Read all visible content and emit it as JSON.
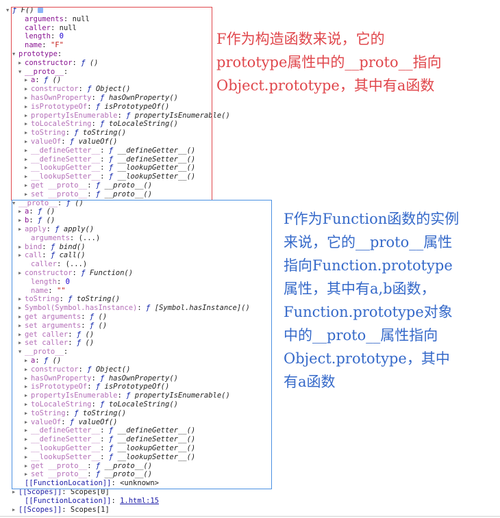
{
  "console_tree": {
    "rows": [
      {
        "indent": 18,
        "arrow": "▼",
        "key": "",
        "sep": "",
        "val_kind": "fn",
        "val": "F()",
        "info": true,
        "key_style": "normal"
      },
      {
        "indent": 36,
        "arrow": "",
        "key": "arguments",
        "sep": ": ",
        "val_kind": "plain",
        "val": "null",
        "key_style": "normal"
      },
      {
        "indent": 36,
        "arrow": "",
        "key": "caller",
        "sep": ": ",
        "val_kind": "plain",
        "val": "null",
        "key_style": "normal"
      },
      {
        "indent": 36,
        "arrow": "",
        "key": "length",
        "sep": ": ",
        "val_kind": "num",
        "val": "0",
        "key_style": "normal"
      },
      {
        "indent": 36,
        "arrow": "",
        "key": "name",
        "sep": ": ",
        "val_kind": "str",
        "val": "\"F\"",
        "key_style": "normal"
      },
      {
        "indent": 27,
        "arrow": "▼",
        "key": "prototype",
        "sep": ":",
        "val_kind": "plain",
        "val": "",
        "key_style": "normal"
      },
      {
        "indent": 36,
        "arrow": "▶",
        "key": "constructor",
        "sep": ": ",
        "val_kind": "fn",
        "val": "()",
        "key_style": "normal"
      },
      {
        "indent": 36,
        "arrow": "▼",
        "key": "__proto__",
        "sep": ":",
        "val_kind": "plain",
        "val": "",
        "key_style": "normal"
      },
      {
        "indent": 45,
        "arrow": "▶",
        "key": "a",
        "sep": ": ",
        "val_kind": "fn",
        "val": "()",
        "key_style": "normal"
      },
      {
        "indent": 45,
        "arrow": "▶",
        "key": "constructor",
        "sep": ": ",
        "val_kind": "fn",
        "val": "Object()",
        "key_style": "dim"
      },
      {
        "indent": 45,
        "arrow": "▶",
        "key": "hasOwnProperty",
        "sep": ": ",
        "val_kind": "fn",
        "val": "hasOwnProperty()",
        "key_style": "dim"
      },
      {
        "indent": 45,
        "arrow": "▶",
        "key": "isPrototypeOf",
        "sep": ": ",
        "val_kind": "fn",
        "val": "isPrototypeOf()",
        "key_style": "dim"
      },
      {
        "indent": 45,
        "arrow": "▶",
        "key": "propertyIsEnumerable",
        "sep": ": ",
        "val_kind": "fn",
        "val": "propertyIsEnumerable()",
        "key_style": "dim"
      },
      {
        "indent": 45,
        "arrow": "▶",
        "key": "toLocaleString",
        "sep": ": ",
        "val_kind": "fn",
        "val": "toLocaleString()",
        "key_style": "dim"
      },
      {
        "indent": 45,
        "arrow": "▶",
        "key": "toString",
        "sep": ": ",
        "val_kind": "fn",
        "val": "toString()",
        "key_style": "dim"
      },
      {
        "indent": 45,
        "arrow": "▶",
        "key": "valueOf",
        "sep": ": ",
        "val_kind": "fn",
        "val": "valueOf()",
        "key_style": "dim"
      },
      {
        "indent": 45,
        "arrow": "▶",
        "key": "__defineGetter__",
        "sep": ": ",
        "val_kind": "fn",
        "val": "__defineGetter__()",
        "key_style": "dim"
      },
      {
        "indent": 45,
        "arrow": "▶",
        "key": "__defineSetter__",
        "sep": ": ",
        "val_kind": "fn",
        "val": "__defineSetter__()",
        "key_style": "dim"
      },
      {
        "indent": 45,
        "arrow": "▶",
        "key": "__lookupGetter__",
        "sep": ": ",
        "val_kind": "fn",
        "val": "__lookupGetter__()",
        "key_style": "dim"
      },
      {
        "indent": 45,
        "arrow": "▶",
        "key": "__lookupSetter__",
        "sep": ": ",
        "val_kind": "fn",
        "val": "__lookupSetter__()",
        "key_style": "dim"
      },
      {
        "indent": 45,
        "arrow": "▶",
        "key": "get __proto__",
        "sep": ": ",
        "val_kind": "fn",
        "val": "__proto__()",
        "key_style": "dim"
      },
      {
        "indent": 45,
        "arrow": "▶",
        "key": "set __proto__",
        "sep": ": ",
        "val_kind": "fn",
        "val": "__proto__()",
        "key_style": "dim"
      },
      {
        "indent": 27,
        "arrow": "▼",
        "key": "__proto__",
        "sep": ": ",
        "val_kind": "fn",
        "val": "()",
        "key_style": "dim"
      },
      {
        "indent": 36,
        "arrow": "▶",
        "key": "a",
        "sep": ": ",
        "val_kind": "fn",
        "val": "()",
        "key_style": "normal"
      },
      {
        "indent": 36,
        "arrow": "▶",
        "key": "b",
        "sep": ": ",
        "val_kind": "fn",
        "val": "()",
        "key_style": "normal"
      },
      {
        "indent": 36,
        "arrow": "▶",
        "key": "apply",
        "sep": ": ",
        "val_kind": "fn",
        "val": "apply()",
        "key_style": "dim"
      },
      {
        "indent": 45,
        "arrow": "",
        "key": "arguments",
        "sep": ": ",
        "val_kind": "plain",
        "val": "(...)",
        "key_style": "dim"
      },
      {
        "indent": 36,
        "arrow": "▶",
        "key": "bind",
        "sep": ": ",
        "val_kind": "fn",
        "val": "bind()",
        "key_style": "dim"
      },
      {
        "indent": 36,
        "arrow": "▶",
        "key": "call",
        "sep": ": ",
        "val_kind": "fn",
        "val": "call()",
        "key_style": "dim"
      },
      {
        "indent": 45,
        "arrow": "",
        "key": "caller",
        "sep": ": ",
        "val_kind": "plain",
        "val": "(...)",
        "key_style": "dim"
      },
      {
        "indent": 36,
        "arrow": "▶",
        "key": "constructor",
        "sep": ": ",
        "val_kind": "fn",
        "val": "Function()",
        "key_style": "dim"
      },
      {
        "indent": 45,
        "arrow": "",
        "key": "length",
        "sep": ": ",
        "val_kind": "num",
        "val": "0",
        "key_style": "dim"
      },
      {
        "indent": 45,
        "arrow": "",
        "key": "name",
        "sep": ": ",
        "val_kind": "str",
        "val": "\"\"",
        "key_style": "dim"
      },
      {
        "indent": 36,
        "arrow": "▶",
        "key": "toString",
        "sep": ": ",
        "val_kind": "fn",
        "val": "toString()",
        "key_style": "dim"
      },
      {
        "indent": 36,
        "arrow": "▶",
        "key": "Symbol(Symbol.hasInstance)",
        "sep": ": ",
        "val_kind": "fn",
        "val": "[Symbol.hasInstance]()",
        "key_style": "dim"
      },
      {
        "indent": 36,
        "arrow": "▶",
        "key": "get arguments",
        "sep": ": ",
        "val_kind": "fn",
        "val": "()",
        "key_style": "dim"
      },
      {
        "indent": 36,
        "arrow": "▶",
        "key": "set arguments",
        "sep": ": ",
        "val_kind": "fn",
        "val": "()",
        "key_style": "dim"
      },
      {
        "indent": 36,
        "arrow": "▶",
        "key": "get caller",
        "sep": ": ",
        "val_kind": "fn",
        "val": "()",
        "key_style": "dim"
      },
      {
        "indent": 36,
        "arrow": "▶",
        "key": "set caller",
        "sep": ": ",
        "val_kind": "fn",
        "val": "()",
        "key_style": "dim"
      },
      {
        "indent": 36,
        "arrow": "▼",
        "key": "__proto__",
        "sep": ":",
        "val_kind": "plain",
        "val": "",
        "key_style": "dim"
      },
      {
        "indent": 45,
        "arrow": "▶",
        "key": "a",
        "sep": ": ",
        "val_kind": "fn",
        "val": "()",
        "key_style": "normal"
      },
      {
        "indent": 45,
        "arrow": "▶",
        "key": "constructor",
        "sep": ": ",
        "val_kind": "fn",
        "val": "Object()",
        "key_style": "dim"
      },
      {
        "indent": 45,
        "arrow": "▶",
        "key": "hasOwnProperty",
        "sep": ": ",
        "val_kind": "fn",
        "val": "hasOwnProperty()",
        "key_style": "dim"
      },
      {
        "indent": 45,
        "arrow": "▶",
        "key": "isPrototypeOf",
        "sep": ": ",
        "val_kind": "fn",
        "val": "isPrototypeOf()",
        "key_style": "dim"
      },
      {
        "indent": 45,
        "arrow": "▶",
        "key": "propertyIsEnumerable",
        "sep": ": ",
        "val_kind": "fn",
        "val": "propertyIsEnumerable()",
        "key_style": "dim"
      },
      {
        "indent": 45,
        "arrow": "▶",
        "key": "toLocaleString",
        "sep": ": ",
        "val_kind": "fn",
        "val": "toLocaleString()",
        "key_style": "dim"
      },
      {
        "indent": 45,
        "arrow": "▶",
        "key": "toString",
        "sep": ": ",
        "val_kind": "fn",
        "val": "toString()",
        "key_style": "dim"
      },
      {
        "indent": 45,
        "arrow": "▶",
        "key": "valueOf",
        "sep": ": ",
        "val_kind": "fn",
        "val": "valueOf()",
        "key_style": "dim"
      },
      {
        "indent": 45,
        "arrow": "▶",
        "key": "__defineGetter__",
        "sep": ": ",
        "val_kind": "fn",
        "val": "__defineGetter__()",
        "key_style": "dim"
      },
      {
        "indent": 45,
        "arrow": "▶",
        "key": "__defineSetter__",
        "sep": ": ",
        "val_kind": "fn",
        "val": "__defineSetter__()",
        "key_style": "dim"
      },
      {
        "indent": 45,
        "arrow": "▶",
        "key": "__lookupGetter__",
        "sep": ": ",
        "val_kind": "fn",
        "val": "__lookupGetter__()",
        "key_style": "dim"
      },
      {
        "indent": 45,
        "arrow": "▶",
        "key": "__lookupSetter__",
        "sep": ": ",
        "val_kind": "fn",
        "val": "__lookupSetter__()",
        "key_style": "dim"
      },
      {
        "indent": 45,
        "arrow": "▶",
        "key": "get __proto__",
        "sep": ": ",
        "val_kind": "fn",
        "val": "__proto__()",
        "key_style": "dim"
      },
      {
        "indent": 45,
        "arrow": "▶",
        "key": "set __proto__",
        "sep": ": ",
        "val_kind": "fn",
        "val": "__proto__()",
        "key_style": "dim"
      },
      {
        "indent": 36,
        "arrow": "",
        "key": "[[FunctionLocation]]",
        "sep": ": ",
        "val_kind": "plain",
        "val": "<unknown>",
        "key_style": "blue"
      },
      {
        "indent": 27,
        "arrow": "▶",
        "key": "[[Scopes]]",
        "sep": ": ",
        "val_kind": "plain",
        "val": "Scopes[0]",
        "key_style": "blue"
      },
      {
        "indent": 36,
        "arrow": "",
        "key": "[[FunctionLocation]]",
        "sep": ": ",
        "val_kind": "link",
        "val": "1.html:15",
        "key_style": "blue"
      },
      {
        "indent": 27,
        "arrow": "▶",
        "key": "[[Scopes]]",
        "sep": ": ",
        "val_kind": "plain",
        "val": "Scopes[1]",
        "key_style": "blue"
      }
    ]
  },
  "fn_glyph": "ƒ",
  "annotations": {
    "red_note": "F作为构造函数来说，它的\nprototype属性中的__proto__指向\nObject.prototype，其中有a函数",
    "blue_note": "F作为Function函数的实例\n来说，它的__proto__属性\n指向Function.prototype\n属性，其中有a,b函数，\nFunction.prototype对象\n中的__proto__属性指向\nObject.prototype，其中\n有a函数"
  },
  "colors": {
    "red_accent": "#e0474c",
    "blue_accent": "#3569c9",
    "key_purple": "#881391"
  }
}
